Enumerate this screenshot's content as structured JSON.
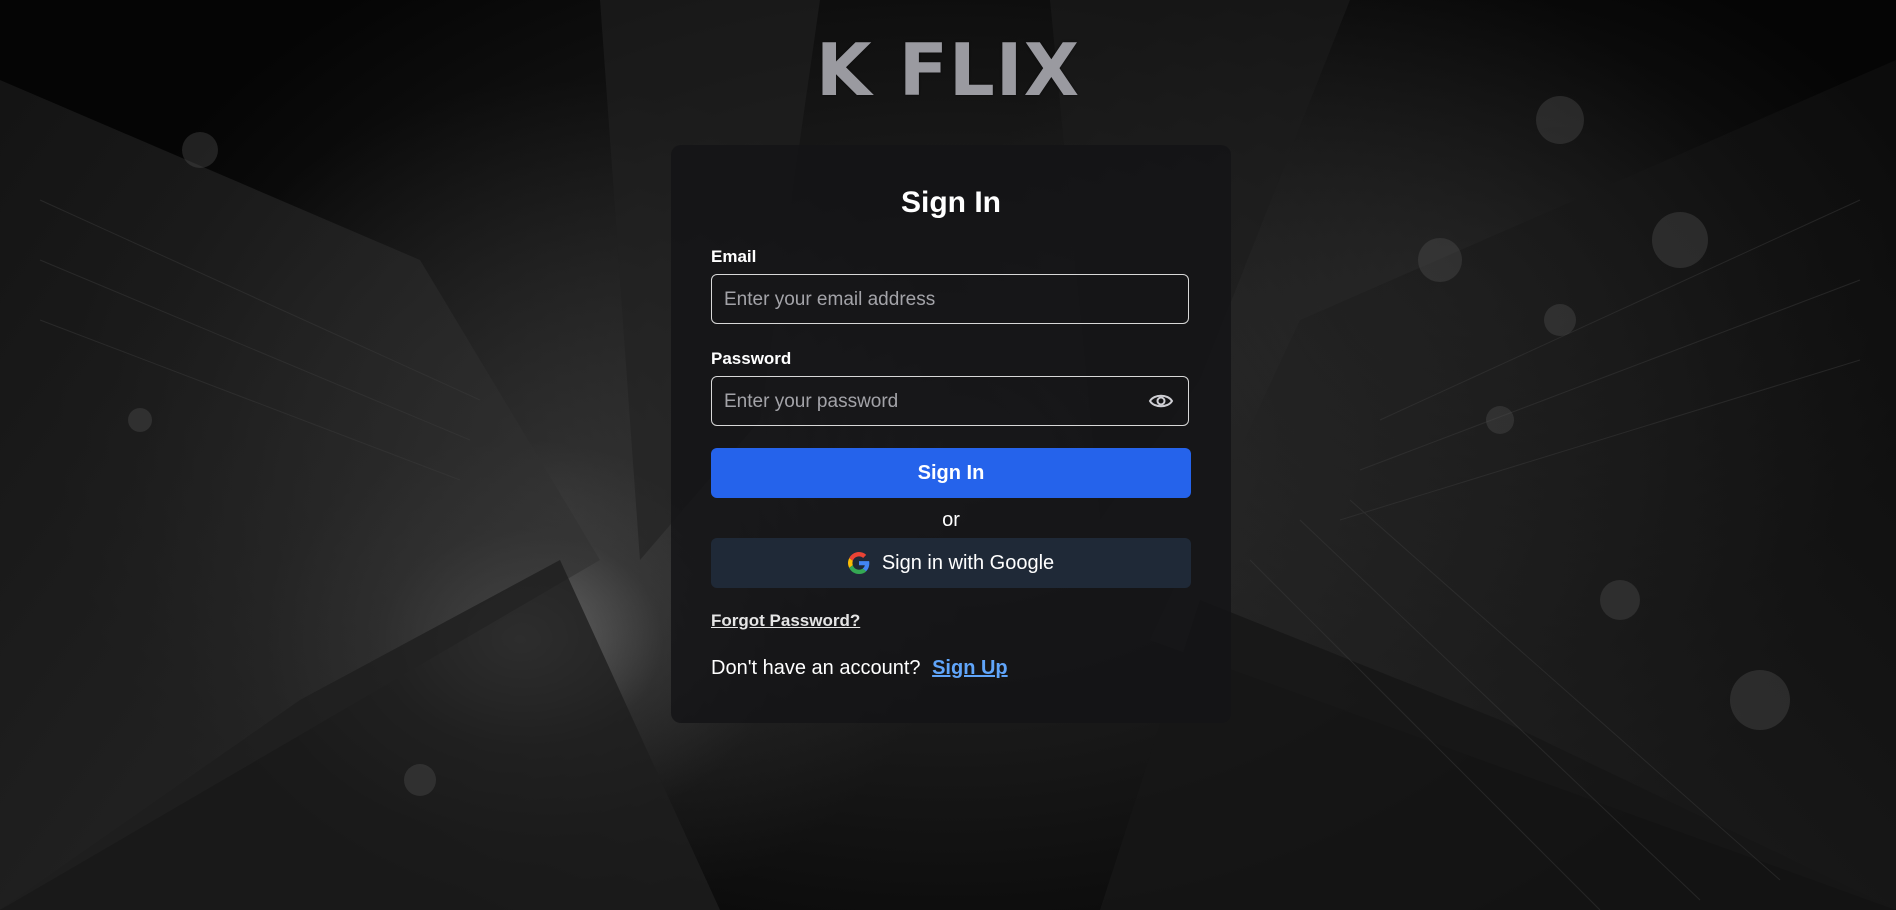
{
  "app": {
    "logo_text": "K FLIX"
  },
  "signin": {
    "title": "Sign In",
    "email_label": "Email",
    "email_placeholder": "Enter your email address",
    "email_value": "",
    "password_label": "Password",
    "password_placeholder": "Enter your password",
    "password_value": "",
    "password_toggle_icon": "eye-icon",
    "submit_label": "Sign In",
    "separator_text": "or",
    "google_label": "Sign in with Google",
    "google_icon": "google-icon",
    "forgot_label": "Forgot Password?",
    "signup_prompt": "Don't have an account?",
    "signup_link": "Sign Up"
  },
  "colors": {
    "primary": "#2563eb",
    "google_button": "#1f2937",
    "link": "#60a5fa",
    "logo": "#9a9aa0"
  }
}
